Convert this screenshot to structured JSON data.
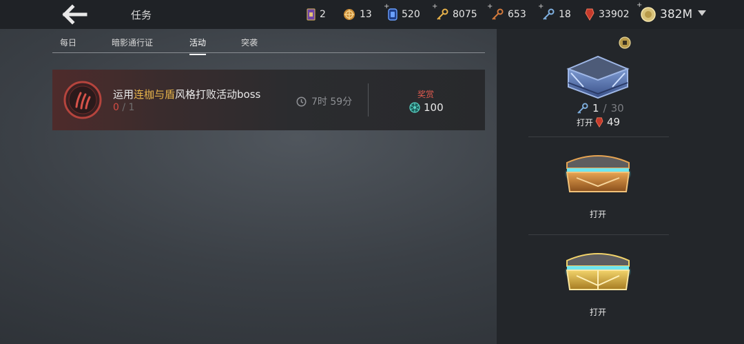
{
  "header": {
    "title": "任务",
    "currencies": [
      {
        "icon": "ticket-icon",
        "value": "2"
      },
      {
        "icon": "gear-coin-icon",
        "value": "13"
      },
      {
        "icon": "blue-gem-icon",
        "value": "520"
      },
      {
        "icon": "gold-key-icon",
        "value": "8075"
      },
      {
        "icon": "bronze-key-icon",
        "value": "653"
      },
      {
        "icon": "silver-key-icon",
        "value": "18"
      },
      {
        "icon": "red-crystal-icon",
        "value": "33902"
      }
    ],
    "gold": "382M"
  },
  "tabs": [
    "每日",
    "暗影通行证",
    "活动",
    "突袭"
  ],
  "active_tab": "活动",
  "mission": {
    "title_prefix": "运用",
    "title_highlight": "连枷与盾",
    "title_suffix": "风格打败活动boss",
    "progress_current": "0",
    "progress_separator": "/",
    "progress_total": "1",
    "time_left": "7时 59分",
    "reward_label": "奖赏",
    "reward_value": "100"
  },
  "chests": {
    "silver": {
      "keys_current": "1",
      "keys_separator": "/",
      "keys_total": "30",
      "open_label": "打开",
      "cost": "49"
    },
    "bronze": {
      "open_label": "打开"
    },
    "gold": {
      "open_label": "打开"
    }
  },
  "colors": {
    "highlight": "#e7b44a",
    "progress_red": "#d74c43",
    "reward_red": "#e05a4f"
  }
}
